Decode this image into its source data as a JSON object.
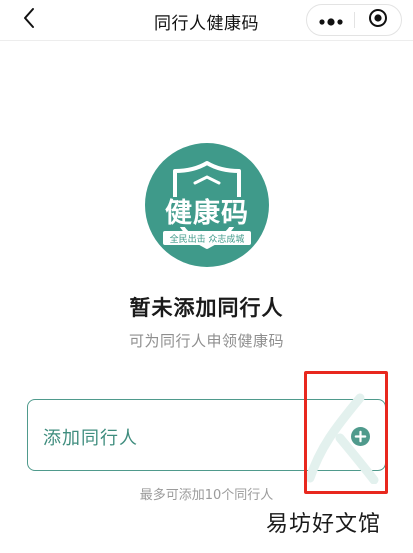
{
  "navbar": {
    "title": "同行人健康码",
    "back_icon": "chevron-left-icon",
    "more_icon": "more-dots-icon",
    "close_icon": "mini-program-close-icon"
  },
  "logo": {
    "main_text": "健康码",
    "slogan": "全民出击 众志成城",
    "color": "#3f9a8a"
  },
  "empty_state": {
    "title": "暂未添加同行人",
    "subtitle": "可为同行人申领健康码"
  },
  "add_card": {
    "label": "添加同行人",
    "icon": "plus-circle-icon",
    "accent_color": "#3f8d7e"
  },
  "limit_note": "最多可添加10个同行人",
  "overlay": {
    "highlight_color": "#e8281e",
    "watermark": "易坊好文馆"
  }
}
